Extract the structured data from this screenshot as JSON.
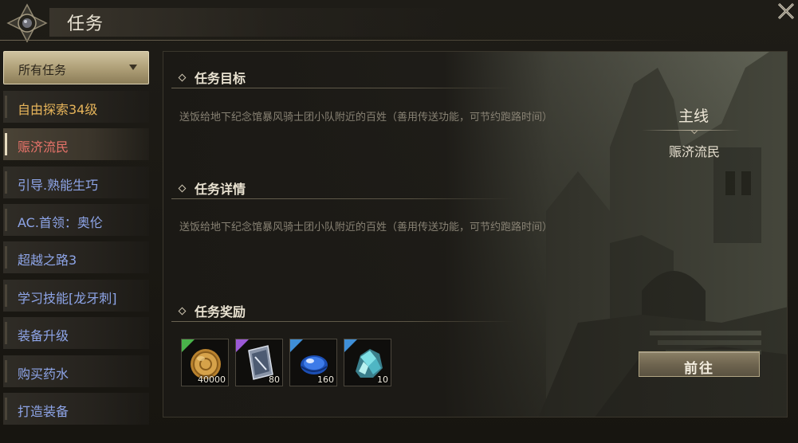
{
  "window": {
    "title": "任务"
  },
  "sidebar": {
    "filter_label": "所有任务",
    "items": [
      {
        "label": "自由探索34级"
      },
      {
        "label": "赈济流民"
      },
      {
        "label": "引导.熟能生巧"
      },
      {
        "label": "AC.首领：奥伦"
      },
      {
        "label": "超越之路3"
      },
      {
        "label": "学习技能[龙牙刺]"
      },
      {
        "label": "装备升级"
      },
      {
        "label": "购买药水"
      },
      {
        "label": "打造装备"
      }
    ]
  },
  "detail": {
    "objective_title": "任务目标",
    "objective_text": "送饭给地下纪念馆暴风骑士团小队附近的百姓（善用传送功能，可节约跑路时间）",
    "details_title": "任务详情",
    "details_text": "送饭给地下纪念馆暴风骑士团小队附近的百姓（善用传送功能，可节约跑路时间）",
    "rewards_title": "任务奖励",
    "quest_type": "主线",
    "quest_name": "赈济流民",
    "go_button": "前往"
  },
  "rewards": [
    {
      "icon": "gold-coin-icon",
      "quantity": "40000",
      "rarity_color": "#49b34a"
    },
    {
      "icon": "skill-scroll-icon",
      "quantity": "80",
      "rarity_color": "#9b59d6"
    },
    {
      "icon": "blue-gem-icon",
      "quantity": "160",
      "rarity_color": "#3f8fd8"
    },
    {
      "icon": "crystal-ore-icon",
      "quantity": "10",
      "rarity_color": "#3f8fd8"
    }
  ],
  "colors": {
    "active_item": "#e8736a",
    "quest_link": "#8ea5e8",
    "gold_quest": "#e6b45a"
  }
}
